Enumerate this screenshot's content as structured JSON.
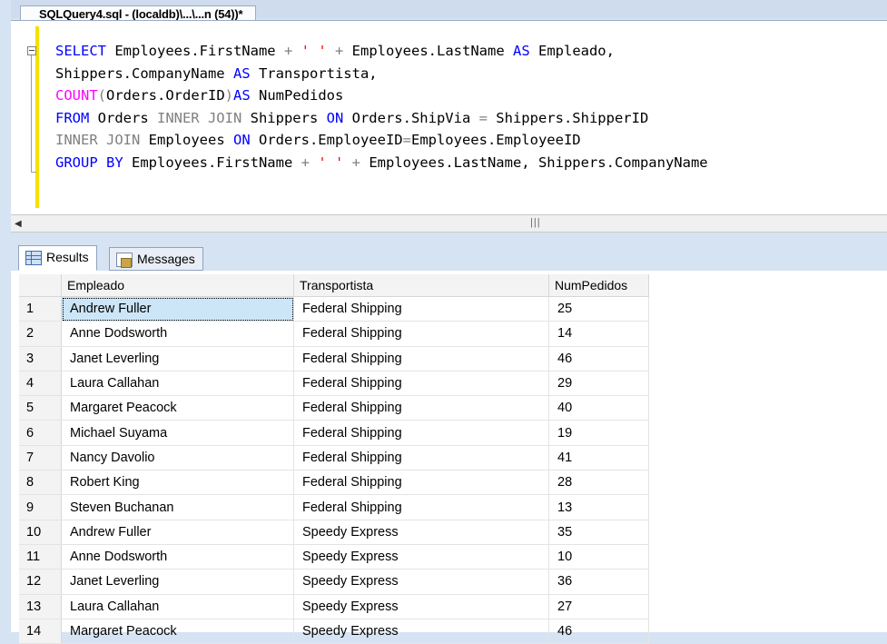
{
  "editor_tab": {
    "title": "SQLQuery4.sql - (localdb)\\...\\...n (54))*"
  },
  "query": {
    "line1": [
      "SELECT",
      " Employees.FirstName ",
      "+",
      " ",
      "' '",
      " ",
      "+",
      " Employees.LastName ",
      "AS",
      " Empleado,"
    ],
    "line2": [
      "Shippers.CompanyName ",
      "AS",
      " Transportista,"
    ],
    "line3": [
      "COUNT",
      "(",
      "Orders.OrderID",
      ")",
      "AS",
      " NumPedidos"
    ],
    "line4": [
      "FROM",
      " Orders ",
      "INNER JOIN",
      " Shippers ",
      "ON",
      " Orders.ShipVia ",
      "=",
      " Shippers.ShipperID"
    ],
    "line5": [
      "INNER JOIN",
      " Employees ",
      "ON",
      " Orders.EmployeeID",
      "=",
      "Employees.EmployeeID"
    ],
    "line6": [
      "GROUP BY",
      " Employees.FirstName ",
      "+",
      " ",
      "' '",
      " ",
      "+",
      " Employees.LastName, Shippers.CompanyName"
    ]
  },
  "result_tabs": {
    "results": "Results",
    "messages": "Messages"
  },
  "grid": {
    "columns": [
      "Empleado",
      "Transportista",
      "NumPedidos"
    ],
    "rows": [
      {
        "n": "1",
        "empleado": "Andrew Fuller",
        "transportista": "Federal Shipping",
        "num": "25"
      },
      {
        "n": "2",
        "empleado": "Anne Dodsworth",
        "transportista": "Federal Shipping",
        "num": "14"
      },
      {
        "n": "3",
        "empleado": "Janet Leverling",
        "transportista": "Federal Shipping",
        "num": "46"
      },
      {
        "n": "4",
        "empleado": "Laura Callahan",
        "transportista": "Federal Shipping",
        "num": "29"
      },
      {
        "n": "5",
        "empleado": "Margaret Peacock",
        "transportista": "Federal Shipping",
        "num": "40"
      },
      {
        "n": "6",
        "empleado": "Michael Suyama",
        "transportista": "Federal Shipping",
        "num": "19"
      },
      {
        "n": "7",
        "empleado": "Nancy Davolio",
        "transportista": "Federal Shipping",
        "num": "41"
      },
      {
        "n": "8",
        "empleado": "Robert King",
        "transportista": "Federal Shipping",
        "num": "28"
      },
      {
        "n": "9",
        "empleado": "Steven Buchanan",
        "transportista": "Federal Shipping",
        "num": "13"
      },
      {
        "n": "10",
        "empleado": "Andrew Fuller",
        "transportista": "Speedy Express",
        "num": "35"
      },
      {
        "n": "11",
        "empleado": "Anne Dodsworth",
        "transportista": "Speedy Express",
        "num": "10"
      },
      {
        "n": "12",
        "empleado": "Janet Leverling",
        "transportista": "Speedy Express",
        "num": "36"
      },
      {
        "n": "13",
        "empleado": "Laura Callahan",
        "transportista": "Speedy Express",
        "num": "27"
      },
      {
        "n": "14",
        "empleado": "Margaret Peacock",
        "transportista": "Speedy Express",
        "num": "46"
      }
    ]
  },
  "colors": {
    "keyword": "#0000ff",
    "operator": "#808080",
    "function": "#ff00ff",
    "string": "#ff0000",
    "selected_cell": "#cde6f7"
  }
}
